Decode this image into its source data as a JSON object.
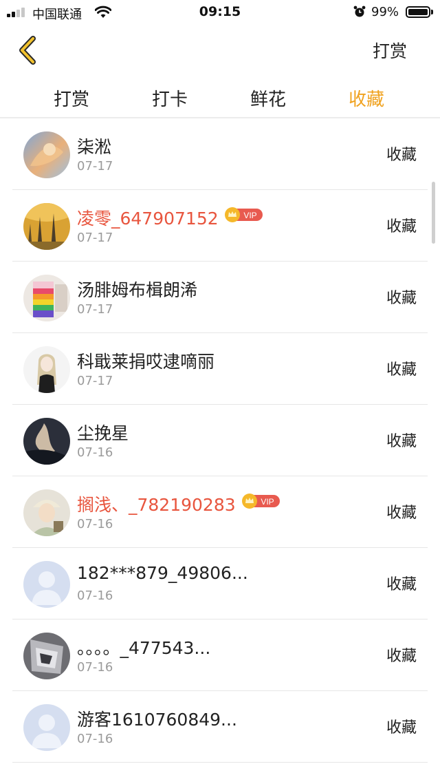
{
  "status_bar": {
    "carrier": "中国联通",
    "time": "09:15",
    "battery_text": "99%",
    "battery_level": 0.99
  },
  "header": {
    "back_icon": "chevron-left-icon",
    "action_label": "打赏"
  },
  "tabs": [
    {
      "label": "打赏",
      "active": false
    },
    {
      "label": "打卡",
      "active": false
    },
    {
      "label": "鲜花",
      "active": false
    },
    {
      "label": "收藏",
      "active": true
    }
  ],
  "colors": {
    "accent": "#f0a21f",
    "vip_name": "#e8553e",
    "vip_badge": "#e85a4f",
    "secondary_text": "#9a9a9a"
  },
  "items": [
    {
      "name": "柒淞",
      "date": "07-17",
      "action": "收藏",
      "vip": false
    },
    {
      "name": "凌零_647907152",
      "date": "07-17",
      "action": "收藏",
      "vip": true,
      "vip_text": "VIP"
    },
    {
      "name": "汤腓姆布楫朗浠",
      "date": "07-17",
      "action": "收藏",
      "vip": false
    },
    {
      "name": "科戢莱捐哎逮嘀丽",
      "date": "07-17",
      "action": "收藏",
      "vip": false
    },
    {
      "name": "尘挽星",
      "date": "07-16",
      "action": "收藏",
      "vip": false
    },
    {
      "name": "搁浅、_782190283",
      "date": "07-16",
      "action": "收藏",
      "vip": true,
      "vip_text": "VIP"
    },
    {
      "name": "182***879_49806...",
      "date": "07-16",
      "action": "收藏",
      "vip": false
    },
    {
      "name": "。。。。_477543...",
      "date": "07-16",
      "action": "收藏",
      "vip": false
    },
    {
      "name": "游客1610760849...",
      "date": "07-16",
      "action": "收藏",
      "vip": false
    }
  ]
}
